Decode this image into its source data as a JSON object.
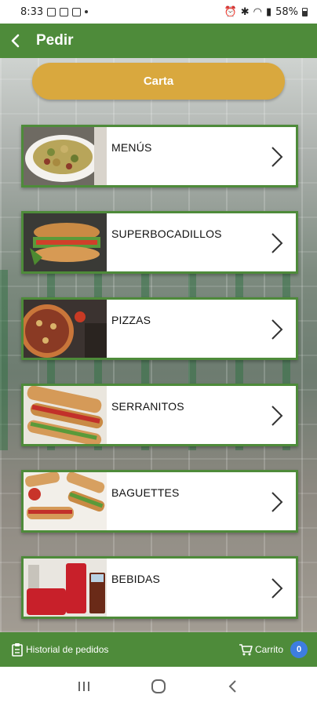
{
  "status_bar": {
    "time": "8:33",
    "battery": "58%"
  },
  "app_bar": {
    "title": "Pedir"
  },
  "carta_button": {
    "label": "Carta"
  },
  "categories": [
    {
      "label": "MENÚS",
      "image": "pasta-salad-photo"
    },
    {
      "label": "SUPERBOCADILLOS",
      "image": "sandwich-photo"
    },
    {
      "label": "PIZZAS",
      "image": "pizza-photo"
    },
    {
      "label": "SERRANITOS",
      "image": "serranito-photo"
    },
    {
      "label": "BAGUETTES",
      "image": "baguettes-photo"
    },
    {
      "label": "BEBIDAS",
      "image": "soft-drinks-photo"
    }
  ],
  "bottom_bar": {
    "history_label": "Historial de pedidos",
    "cart_label": "Carrito",
    "cart_count": "0"
  },
  "colors": {
    "primary": "#4e8b3a",
    "accent": "#d9a83e",
    "badge": "#3d7de0"
  }
}
